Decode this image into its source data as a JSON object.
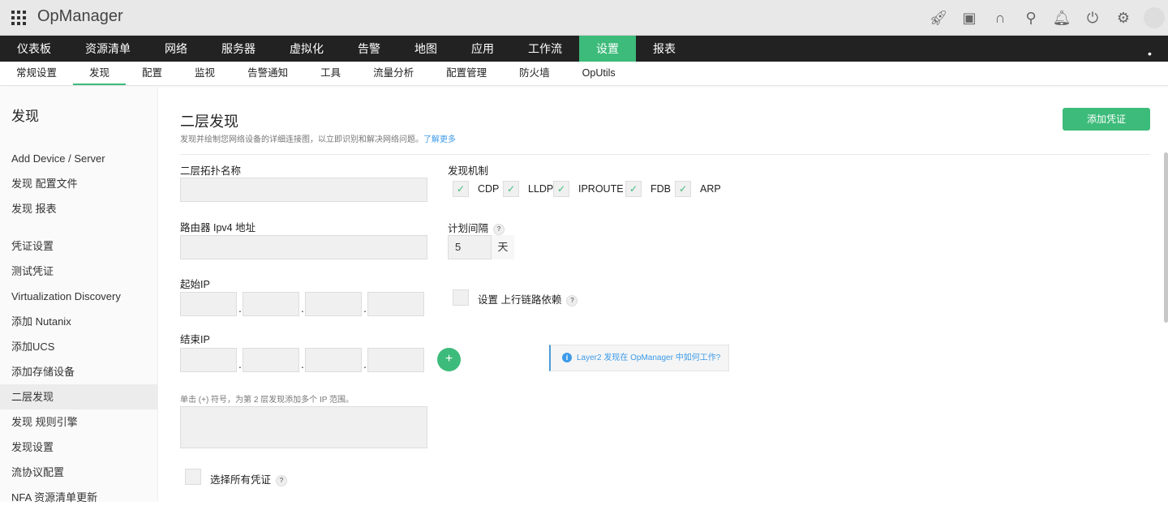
{
  "app": {
    "title": "OpManager"
  },
  "header_icons": [
    "rocket-icon",
    "presentation-icon",
    "headset-icon",
    "search-icon",
    "bell-icon",
    "plug-icon",
    "gear-icon",
    "avatar"
  ],
  "nav": [
    "仪表板",
    "资源清单",
    "网络",
    "服务器",
    "虚拟化",
    "告警",
    "地图",
    "应用",
    "工作流",
    "设置",
    "报表"
  ],
  "subnav": [
    "常规设置",
    "发现",
    "配置",
    "监视",
    "告警通知",
    "工具",
    "流量分析",
    "配置管理",
    "防火墙",
    "OpUtils"
  ],
  "sidebar": {
    "title": "发现",
    "groups": [
      [
        "Add Device / Server",
        "发现 配置文件",
        "发现 报表"
      ],
      [
        "凭证设置",
        "测试凭证",
        "Virtualization Discovery",
        "添加 Nutanix",
        "添加UCS",
        "添加存储设备",
        "二层发现",
        "发现 规则引擎",
        "发现设置",
        "流协议配置",
        "NFA 资源清单更新"
      ]
    ]
  },
  "page": {
    "title": "二层发现",
    "description": "发现并绘制您网络设备的详细连接图，以立即识别和解决网络问题。",
    "learn_more": "了解更多",
    "add_credential": "添加凭证"
  },
  "form": {
    "topology_name_label": "二层拓扑名称",
    "topology_name": "",
    "router_label": "路由器 Ipv4 地址",
    "router": "",
    "start_ip_label": "起始IP",
    "end_ip_label": "结束IP",
    "mechanism_label": "发现机制",
    "mechanisms": [
      {
        "label": "CDP",
        "checked": true
      },
      {
        "label": "LLDP",
        "checked": true
      },
      {
        "label": "IPROUTE",
        "checked": true
      },
      {
        "label": "FDB",
        "checked": true
      },
      {
        "label": "ARP",
        "checked": true
      }
    ],
    "interval_label": "计划间隔",
    "interval_value": "5",
    "interval_unit": "天",
    "uplink_label": "设置 上行链路依赖",
    "info_text": "Layer2 发现在 OpManager 中如何工作?",
    "hint": "单击 (+) 符号，为第 2 层发现添加多个 IP 范围。",
    "select_all_label": "选择所有凭证",
    "help": "?",
    "plus": "+",
    "check": "✓"
  },
  "colors": {
    "accent": "#3dbb7a",
    "link": "#3d9be9",
    "nav_bg": "#222222"
  }
}
